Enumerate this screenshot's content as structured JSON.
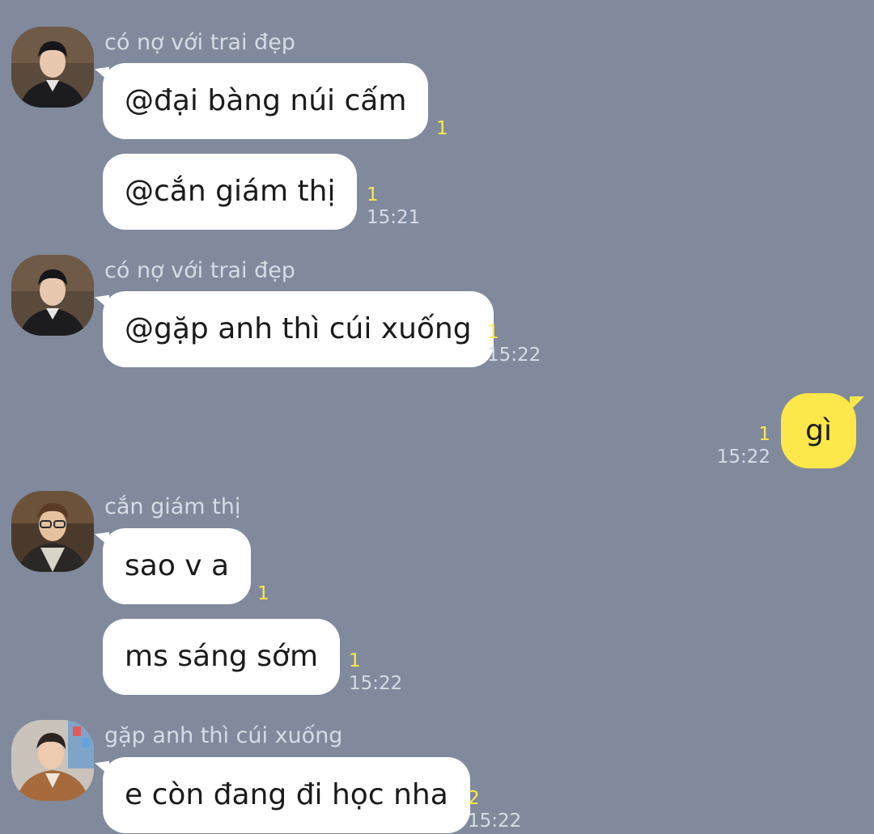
{
  "colors": {
    "background": "#808a9c",
    "incoming_bubble": "#ffffff",
    "outgoing_bubble": "#fde74a",
    "unread_count": "#ffe94a",
    "meta_text": "#d8dce3"
  },
  "messages": [
    {
      "sender": "có nợ với trai đẹp",
      "avatar_icon": "profile-photo-icon",
      "bubbles": [
        {
          "text": "@đại bàng núi cấm",
          "count": "1",
          "time": ""
        },
        {
          "text": "@cắn giám thị",
          "count": "1",
          "time": "15:21"
        }
      ]
    },
    {
      "sender": "có nợ với trai đẹp",
      "avatar_icon": "profile-photo-icon",
      "bubbles": [
        {
          "text": "@gặp anh thì cúi xuống",
          "count": "1",
          "time": "15:22"
        }
      ]
    },
    {
      "sender": "",
      "outgoing": true,
      "bubbles": [
        {
          "text": "gì",
          "count": "1",
          "time": "15:22"
        }
      ]
    },
    {
      "sender": "cắn giám thị",
      "avatar_icon": "profile-photo-icon",
      "bubbles": [
        {
          "text": "sao v a",
          "count": "1",
          "time": ""
        },
        {
          "text": "ms sáng sớm",
          "count": "1",
          "time": "15:22"
        }
      ]
    },
    {
      "sender": "gặp anh thì cúi xuống",
      "avatar_icon": "profile-photo-icon",
      "bubbles": [
        {
          "text": "e còn đang đi học nha",
          "count": "2",
          "time": "15:22"
        }
      ]
    }
  ]
}
